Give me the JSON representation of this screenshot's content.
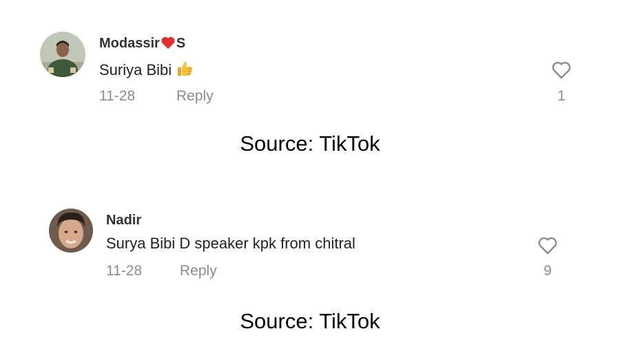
{
  "comments": [
    {
      "username_pre": "Modassir",
      "username_post": "S",
      "text": "Suriya Bibi",
      "date": "11-28",
      "reply_label": "Reply",
      "likes": "1"
    },
    {
      "username": "Nadir",
      "text": "Surya Bibi D speaker kpk from chitral",
      "date": "11-28",
      "reply_label": "Reply",
      "likes": "9"
    }
  ],
  "source_captions": [
    "Source: TikTok",
    "Source: TikTok"
  ],
  "icons": {
    "like": "heart-outline-icon",
    "username_emoji": "red-heart-icon",
    "text_emoji": "thumbs-up-icon"
  },
  "colors": {
    "meta_gray": "#8a8b91",
    "heart_red": "#e0312f",
    "thumb_yellow": "#f5c33b"
  }
}
